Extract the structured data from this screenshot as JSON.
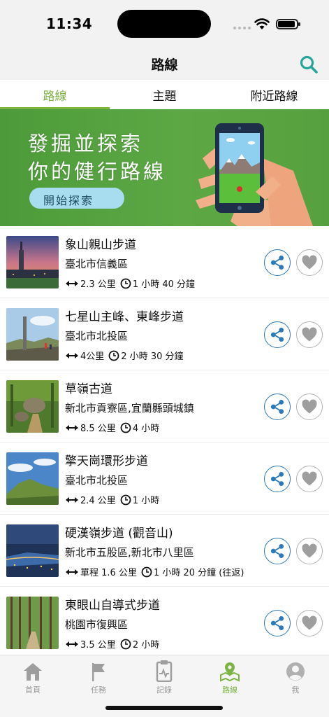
{
  "status_bar": {
    "time": "11:34"
  },
  "nav": {
    "title": "路線",
    "search_icon": "search-icon"
  },
  "tabs": [
    {
      "label": "路線",
      "active": true
    },
    {
      "label": "主題",
      "active": false
    },
    {
      "label": "附近路線",
      "active": false
    }
  ],
  "banner": {
    "line1": "發掘並探索",
    "line2": "你的健行路線",
    "cta": "開始探索"
  },
  "routes": [
    {
      "name": "象山親山步道",
      "area": "臺北市信義區",
      "distance": "2.3 公里",
      "duration": "1 小時 40 分鐘"
    },
    {
      "name": "七星山主峰、東峰步道",
      "area": "臺北市北投區",
      "distance": "4公里",
      "duration": "2 小時 30 分鐘"
    },
    {
      "name": "草嶺古道",
      "area": "新北市貢寮區,宜蘭縣頭城鎮",
      "distance": "8.5 公里",
      "duration": "4 小時"
    },
    {
      "name": "擎天崗環形步道",
      "area": "臺北市北投區",
      "distance": "2.4 公里",
      "duration": "1 小時"
    },
    {
      "name": "硬漢嶺步道 (觀音山)",
      "area": "新北市五股區,新北市八里區",
      "distance": "單程 1.6 公里",
      "duration": "1 小時 20 分鐘 (往返)"
    },
    {
      "name": "東眼山自導式步道",
      "area": "桃園市復興區",
      "distance": "3.5 公里",
      "duration": "2 小時"
    }
  ],
  "bottom_tabs": [
    {
      "label": "首頁",
      "icon": "home-icon",
      "active": false
    },
    {
      "label": "任務",
      "icon": "flag-icon",
      "active": false
    },
    {
      "label": "記錄",
      "icon": "record-icon",
      "active": false
    },
    {
      "label": "路線",
      "icon": "map-pin-icon",
      "active": true
    },
    {
      "label": "我",
      "icon": "profile-icon",
      "active": false
    }
  ],
  "colors": {
    "accent": "#7cb342",
    "share": "#2b79b8",
    "search": "#26a69a"
  }
}
